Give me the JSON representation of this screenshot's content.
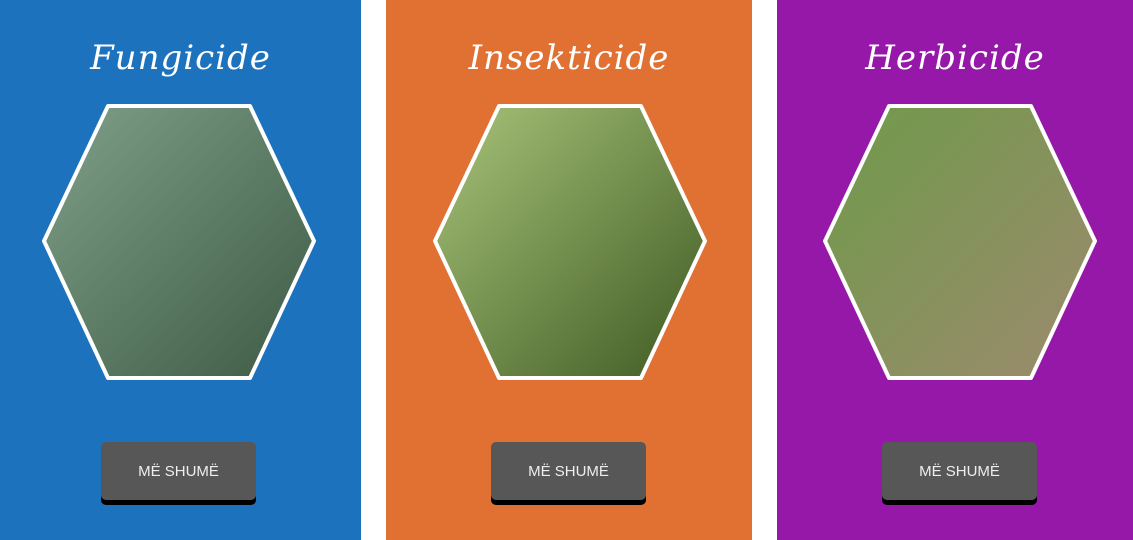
{
  "panels": [
    {
      "title": "Fungicide",
      "button": "MË SHUMË",
      "color": "#1d72bd",
      "image": "leaf-with-fungus",
      "g1": "#7fa08a",
      "g2": "#3d5a44"
    },
    {
      "title": "Insekticide",
      "button": "MË SHUMË",
      "color": "#e07133",
      "image": "colorado-beetle",
      "g1": "#a8c47a",
      "g2": "#3f5a22"
    },
    {
      "title": "Herbicide",
      "button": "MË SHUMË",
      "color": "#9518a8",
      "image": "crop-rows",
      "g1": "#6f9a4a",
      "g2": "#9c8a6e"
    }
  ]
}
